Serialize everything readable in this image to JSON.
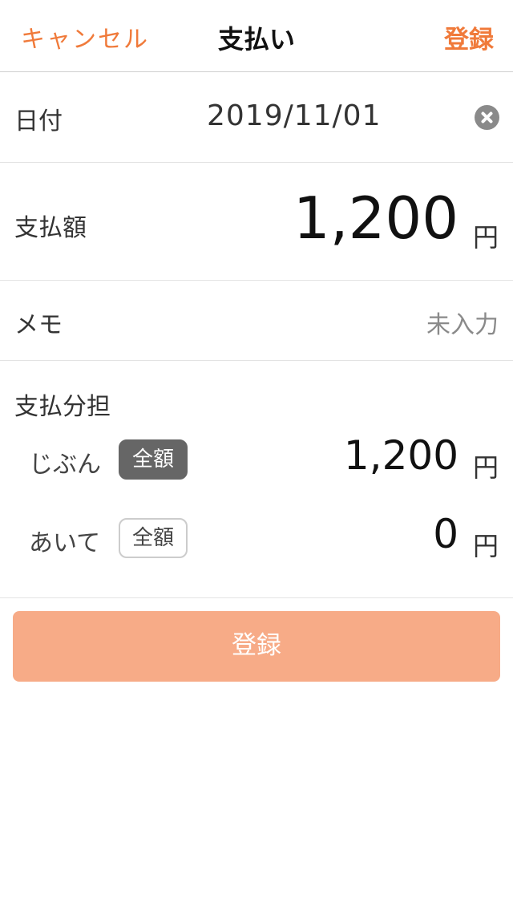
{
  "nav": {
    "cancel_label": "キャンセル",
    "title": "支払い",
    "register_label": "登録"
  },
  "date_row": {
    "label": "日付",
    "value": "2019/11/01",
    "clear_icon": "clear-circle-icon"
  },
  "amount_row": {
    "label": "支払額",
    "value": "1,200",
    "unit": "円"
  },
  "memo_row": {
    "label": "メモ",
    "placeholder": "未入力"
  },
  "split": {
    "label": "支払分担",
    "self": {
      "label": "じぶん",
      "full_button": "全額",
      "full_selected": true,
      "amount": "1,200",
      "unit": "円"
    },
    "partner": {
      "label": "あいて",
      "full_button": "全額",
      "full_selected": false,
      "amount": "0",
      "unit": "円"
    }
  },
  "submit": {
    "label": "登録"
  },
  "colors": {
    "accent": "#f07a3a",
    "submit_background": "#f7ab87",
    "selected_button": "#666666"
  }
}
